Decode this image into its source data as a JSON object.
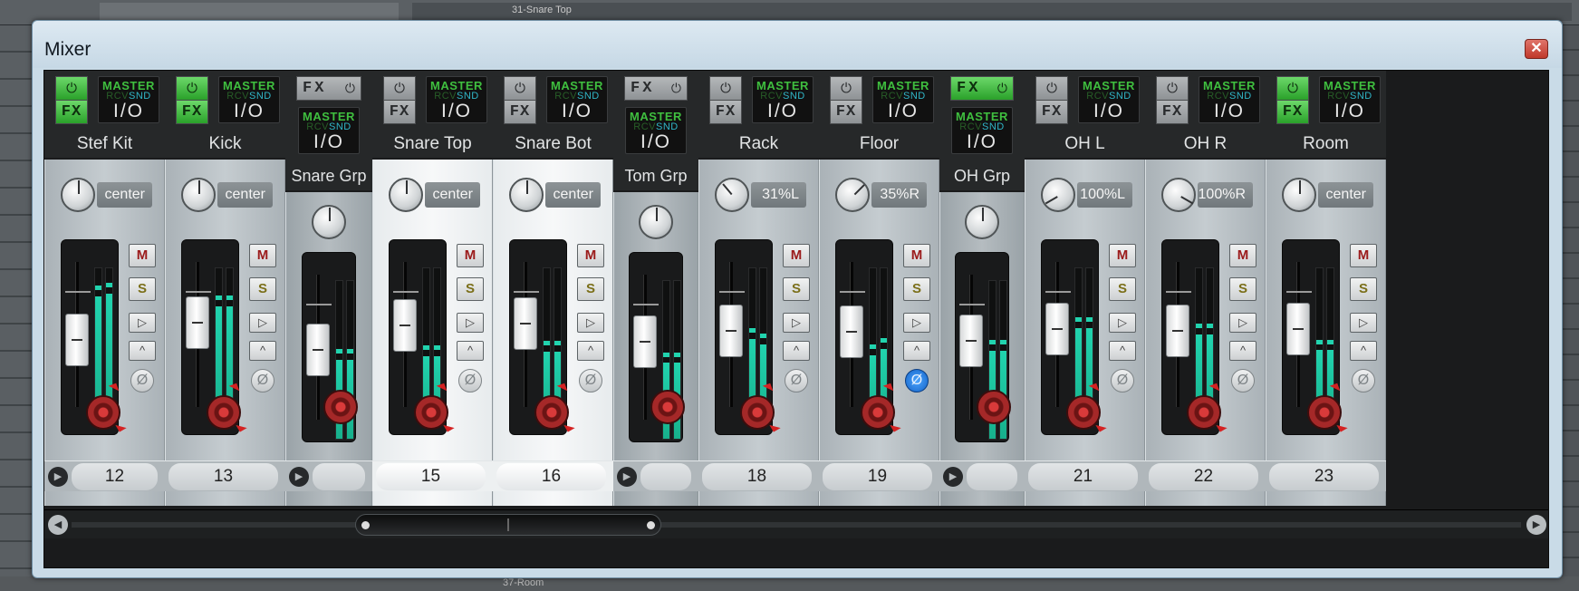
{
  "background": {
    "top_track_label": "31-Snare Top",
    "bottom_track_label": "37-Room"
  },
  "window": {
    "title": "Mixer",
    "close_label": "✕"
  },
  "labels": {
    "master": "MASTER",
    "rcv": "RCV",
    "snd": "SND",
    "io": "I/O",
    "fx": "FX",
    "mute": "M",
    "solo": "S",
    "power": "⏻"
  },
  "strips": [
    {
      "name": "Stef Kit",
      "number": "12",
      "pan": "center",
      "pan_angle": 0,
      "fx_on": true,
      "group": false,
      "fader": 0.62,
      "meter_l": 0.82,
      "meter_r": 0.84,
      "phase_on": false
    },
    {
      "name": "Kick",
      "number": "13",
      "pan": "center",
      "pan_angle": 0,
      "fx_on": true,
      "group": false,
      "fader": 0.75,
      "meter_l": 0.76,
      "meter_r": 0.76,
      "phase_on": false
    },
    {
      "name": "Snare Grp",
      "number": "",
      "pan": "",
      "pan_angle": 0,
      "fx_on": false,
      "group": true,
      "fader": 0.64,
      "meter_l": 0.5,
      "meter_r": 0.5,
      "phase_on": false
    },
    {
      "name": "Snare Top",
      "number": "15",
      "pan": "center",
      "pan_angle": 0,
      "fx_on": false,
      "group": false,
      "fader": 0.73,
      "meter_l": 0.44,
      "meter_r": 0.44,
      "phase_on": false
    },
    {
      "name": "Snare Bot",
      "number": "16",
      "pan": "center",
      "pan_angle": 0,
      "fx_on": false,
      "group": false,
      "fader": 0.74,
      "meter_l": 0.47,
      "meter_r": 0.47,
      "phase_on": false
    },
    {
      "name": "Tom Grp",
      "number": "",
      "pan": "",
      "pan_angle": 0,
      "fx_on": false,
      "group": true,
      "fader": 0.7,
      "meter_l": 0.48,
      "meter_r": 0.48,
      "phase_on": false
    },
    {
      "name": "Rack",
      "number": "18",
      "pan": "31%L",
      "pan_angle": -40,
      "fx_on": false,
      "group": false,
      "fader": 0.69,
      "meter_l": 0.55,
      "meter_r": 0.52,
      "phase_on": false
    },
    {
      "name": "Floor",
      "number": "19",
      "pan": "35%R",
      "pan_angle": 45,
      "fx_on": false,
      "group": false,
      "fader": 0.68,
      "meter_l": 0.45,
      "meter_r": 0.49,
      "phase_on": true
    },
    {
      "name": "OH Grp",
      "number": "",
      "pan": "",
      "pan_angle": 0,
      "fx_on": true,
      "group": true,
      "fader": 0.71,
      "meter_l": 0.56,
      "meter_r": 0.56,
      "phase_on": false
    },
    {
      "name": "OH L",
      "number": "21",
      "pan": "100%L",
      "pan_angle": -120,
      "fx_on": false,
      "group": false,
      "fader": 0.7,
      "meter_l": 0.62,
      "meter_r": 0.62,
      "phase_on": false
    },
    {
      "name": "OH R",
      "number": "22",
      "pan": "100%R",
      "pan_angle": 120,
      "fx_on": false,
      "group": false,
      "fader": 0.69,
      "meter_l": 0.58,
      "meter_r": 0.58,
      "phase_on": false
    },
    {
      "name": "Room",
      "number": "23",
      "pan": "center",
      "pan_angle": 0,
      "fx_on": true,
      "group": false,
      "fader": 0.7,
      "meter_l": 0.48,
      "meter_r": 0.48,
      "phase_on": false
    }
  ]
}
